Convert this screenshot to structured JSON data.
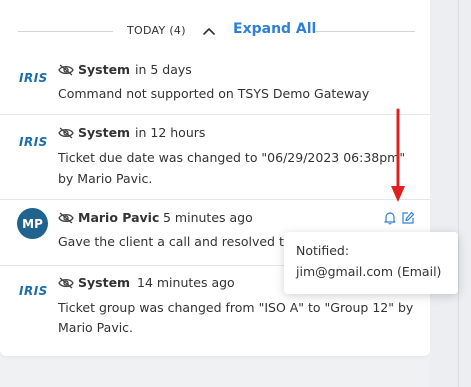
{
  "section": {
    "label": "TODAY (4)",
    "expand_label": "Expand All"
  },
  "colors": {
    "accent": "#2f80d6",
    "avatar_bg": "#20638f",
    "annotation_arrow": "#e02020"
  },
  "entries": [
    {
      "author": "System",
      "time": "in 5 days",
      "message_lines": [
        "Command not supported on TSYS Demo Gateway"
      ],
      "logo": "IRIS"
    },
    {
      "author": "System",
      "time": "in 12 hours",
      "message_lines": [
        "Ticket due date was changed to \"06/29/2023 06:38pm\"",
        "by Mario Pavic."
      ],
      "logo": "IRIS"
    },
    {
      "author": "Mario Pavic",
      "time": "5 minutes ago",
      "message_lines": [
        "Gave the client a call and resolved th"
      ],
      "avatar": "MP"
    },
    {
      "author": "System",
      "time": "14 minutes ago",
      "message_lines": [
        "Ticket group was changed from \"ISO A\" to \"Group 12\" by",
        "Mario Pavic."
      ],
      "logo": "IRIS"
    }
  ],
  "tooltip": {
    "title": "Notified:",
    "detail": "jim@gmail.com (Email)"
  },
  "icons": {
    "visibility": "eye-off-icon",
    "collapse": "chevron-up-icon",
    "notify": "bell-icon",
    "edit": "edit-icon"
  }
}
